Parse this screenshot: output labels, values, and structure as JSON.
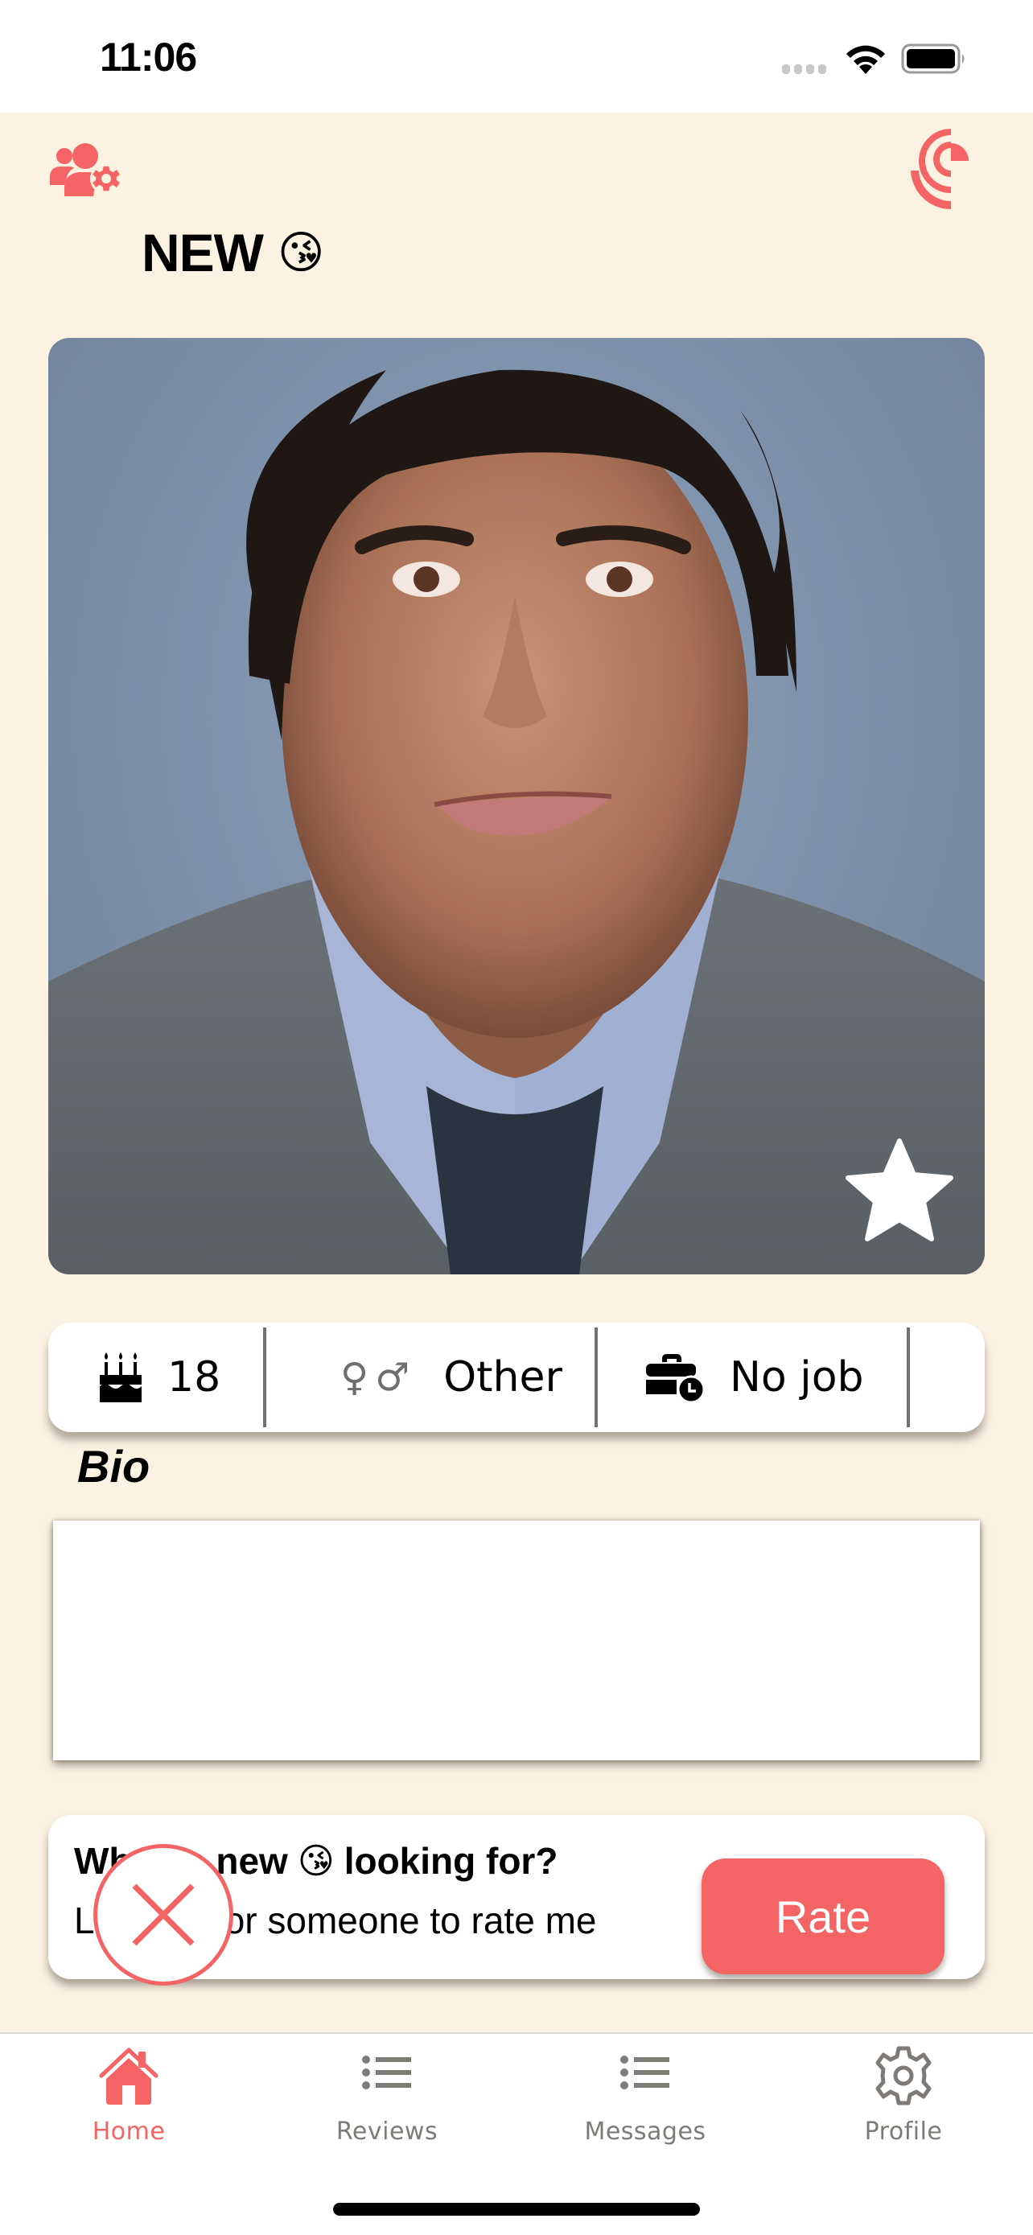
{
  "status_bar": {
    "time": "11:06",
    "icons": [
      "cellular-signal-icon",
      "wifi-icon",
      "battery-icon"
    ]
  },
  "header": {
    "left_icon": "users-settings-icon",
    "right_icon": "logo-icon",
    "title": "NEW",
    "title_emoji": "😘"
  },
  "profile": {
    "photo_alt": "Profile photo of a smiling man with dark hair wearing a grey sweater over a light blue collared shirt",
    "favorite_icon": "star-icon",
    "age_icon": "birthday-cake-icon",
    "age": "18",
    "gender_symbols": "♀♂",
    "gender": "Other",
    "job_icon": "briefcase-clock-icon",
    "job": "No job"
  },
  "bio": {
    "label": "Bio",
    "value": ""
  },
  "looking_for": {
    "title_prefix": "What is new",
    "title_emoji": "😘",
    "title_suffix": "looking for?",
    "subtitle": "Looking for someone to rate me",
    "rate_label": "Rate"
  },
  "close_button": {
    "icon": "close-icon"
  },
  "tab_bar": {
    "tabs": [
      {
        "label": "Home",
        "icon": "home-icon",
        "active": true
      },
      {
        "label": "Reviews",
        "icon": "list-icon",
        "active": false
      },
      {
        "label": "Messages",
        "icon": "list-icon",
        "active": false
      },
      {
        "label": "Profile",
        "icon": "gear-icon",
        "active": false
      }
    ]
  },
  "colors": {
    "accent": "#F46464",
    "background": "#FCF2E2",
    "inactive_tab": "#7E7A75"
  }
}
